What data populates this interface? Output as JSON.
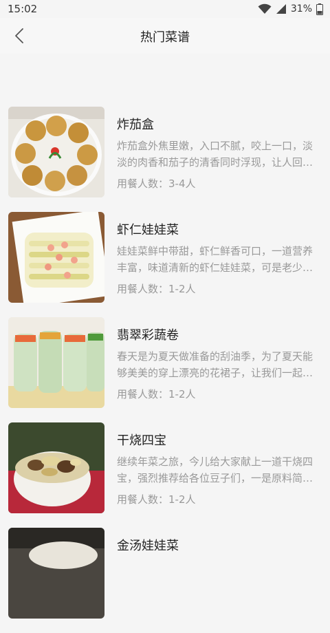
{
  "status": {
    "time": "15:02",
    "battery": "31%",
    "icons": [
      "wifi-icon",
      "cell-signal-icon",
      "battery-icon"
    ]
  },
  "header": {
    "title": "热门菜谱",
    "back_icon": "chevron-left-icon"
  },
  "recipes": [
    {
      "title": "炸茄盒",
      "desc": "炸茄盒外焦里嫩，入口不腻，咬上一口，淡淡的肉香和茄子的清香同时浮现，让人回味无穷。",
      "servings": "用餐人数：3-4人"
    },
    {
      "title": "虾仁娃娃菜",
      "desc": "娃娃菜鲜中带甜，虾仁鲜香可口，一道营养丰富，味道清新的虾仁娃娃菜，可是老少皆宜。",
      "servings": "用餐人数：1-2人"
    },
    {
      "title": "翡翠彩蔬卷",
      "desc": "春天是为夏天做准备的刮油季，为了夏天能够美美的穿上漂亮的花裙子，让我们一起来做这道菜吧。",
      "servings": "用餐人数：1-2人"
    },
    {
      "title": "干烧四宝",
      "desc": "继续年菜之旅，今儿给大家献上一道干烧四宝，强烈推荐给各位豆子们，一是原料简单，二是做法方便。",
      "servings": "用餐人数：1-2人"
    },
    {
      "title": "金汤娃娃菜",
      "desc": "",
      "servings": ""
    }
  ]
}
